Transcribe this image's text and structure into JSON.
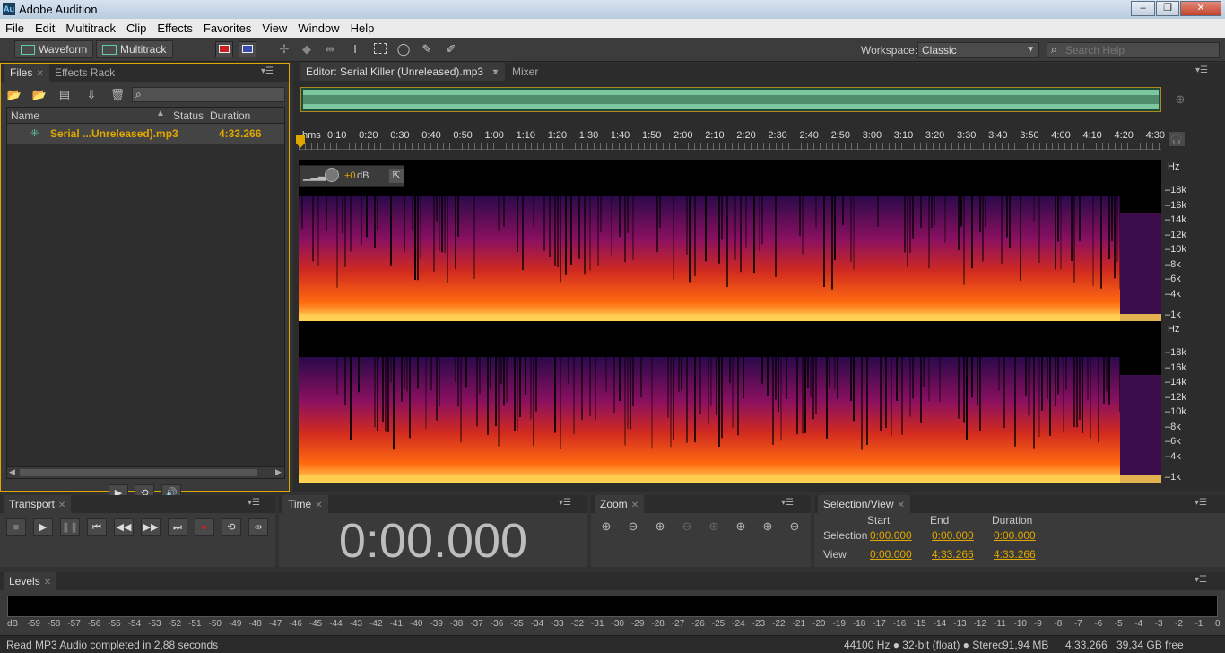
{
  "window": {
    "title": "Adobe Audition",
    "app_icon": "Au",
    "minimize": "–",
    "restore": "❐",
    "close": "✕"
  },
  "menu": [
    "File",
    "Edit",
    "Multitrack",
    "Clip",
    "Effects",
    "Favorites",
    "View",
    "Window",
    "Help"
  ],
  "toolbar": {
    "waveform_label": "Waveform",
    "multitrack_label": "Multitrack",
    "workspace_label": "Workspace:",
    "workspace_value": "Classic",
    "search_placeholder": "Search Help"
  },
  "files_panel": {
    "tabs": [
      "Files",
      "Effects Rack"
    ],
    "columns": [
      "Name",
      "Status",
      "Duration"
    ],
    "rows": [
      {
        "name": "Serial ...Unreleased).mp3",
        "status": "",
        "duration": "4:33.266"
      }
    ],
    "search_value": ""
  },
  "editor": {
    "tab_label": "Editor: Serial Killer (Unreleased).mp3",
    "mixer_label": "Mixer",
    "ruler_unit": "hms",
    "ruler_labels": [
      "0:10",
      "0:20",
      "0:30",
      "0:40",
      "0:50",
      "1:00",
      "1:10",
      "1:20",
      "1:30",
      "1:40",
      "1:50",
      "2:00",
      "2:10",
      "2:20",
      "2:30",
      "2:40",
      "2:50",
      "3:00",
      "3:10",
      "3:20",
      "3:30",
      "3:40",
      "3:50",
      "4:00",
      "4:10",
      "4:20",
      "4:30"
    ],
    "hud_gain": "+0",
    "hud_unit": "dB",
    "freq_unit": "Hz",
    "freq_labels": [
      "18k",
      "16k",
      "14k",
      "12k",
      "10k",
      "8k",
      "6k",
      "4k",
      "1k"
    ]
  },
  "transport": {
    "tab": "Transport",
    "buttons": [
      "stop-icon",
      "play-icon",
      "pause-icon",
      "skip-start-icon",
      "rewind-icon",
      "fast-forward-icon",
      "skip-end-icon",
      "record-icon",
      "loop-icon",
      "skip-selection-icon"
    ]
  },
  "time_panel": {
    "tab": "Time",
    "value": "0:00.000"
  },
  "zoom_panel": {
    "tab": "Zoom"
  },
  "selection_panel": {
    "tab": "Selection/View",
    "col_start": "Start",
    "col_end": "End",
    "col_duration": "Duration",
    "selection_label": "Selection",
    "view_label": "View",
    "selection": {
      "start": "0:00.000",
      "end": "0:00.000",
      "duration": "0:00.000"
    },
    "view": {
      "start": "0:00.000",
      "end": "4:33.266",
      "duration": "4:33.266"
    }
  },
  "levels_panel": {
    "tab": "Levels",
    "scale": [
      "dB",
      "-59",
      "-58",
      "-57",
      "-56",
      "-55",
      "-54",
      "-53",
      "-52",
      "-51",
      "-50",
      "-49",
      "-48",
      "-47",
      "-46",
      "-45",
      "-44",
      "-43",
      "-42",
      "-41",
      "-40",
      "-39",
      "-38",
      "-37",
      "-36",
      "-35",
      "-34",
      "-33",
      "-32",
      "-31",
      "-30",
      "-29",
      "-28",
      "-27",
      "-26",
      "-25",
      "-24",
      "-23",
      "-22",
      "-21",
      "-20",
      "-19",
      "-18",
      "-17",
      "-16",
      "-15",
      "-14",
      "-13",
      "-12",
      "-11",
      "-10",
      "-9",
      "-8",
      "-7",
      "-6",
      "-5",
      "-4",
      "-3",
      "-2",
      "-1",
      "0"
    ]
  },
  "status": {
    "message": "Read MP3 Audio completed in 2,88 seconds",
    "format": "44100 Hz ● 32-bit (float) ● Stereo",
    "size": "91,94 MB",
    "duration": "4:33.266",
    "free": "39,34 GB free"
  },
  "colors": {
    "accent": "#e0a700",
    "waveform_green": "#5fd0a0",
    "spectral_hot": "#ffd050"
  }
}
